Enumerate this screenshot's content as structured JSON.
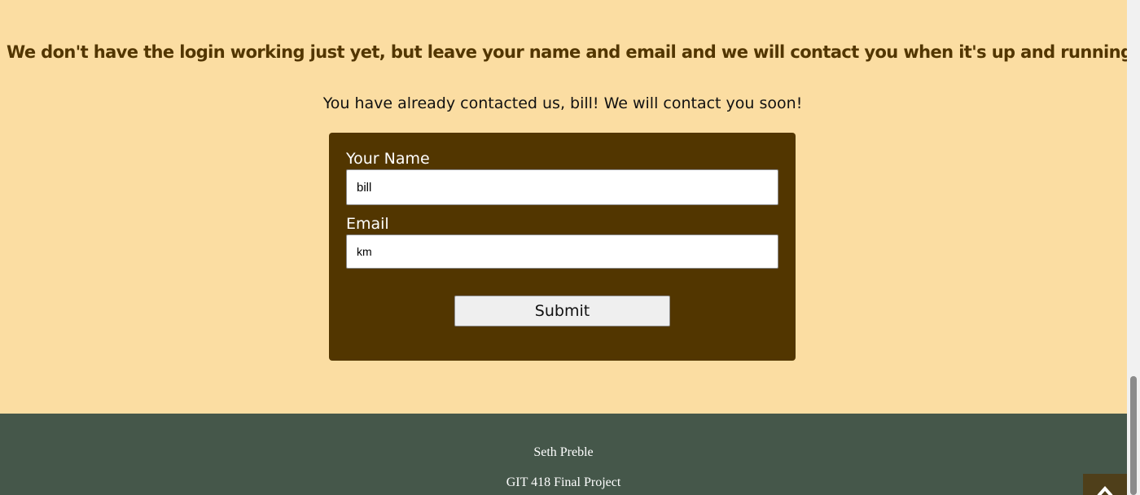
{
  "main": {
    "headline": "We don't have the login working just yet, but leave your name and email and we will contact you when it's up and running!",
    "notice": "You have already contacted us, bill! We will contact you soon!"
  },
  "form": {
    "name_label": "Your Name",
    "name_value": "bill",
    "email_label": "Email",
    "email_value": "km",
    "submit_label": "Submit"
  },
  "footer": {
    "author": "Seth Preble",
    "project": "GIT 418 Final Project"
  },
  "icons": {
    "back_to_top": "arrow-up-icon"
  },
  "colors": {
    "page_background": "#fbdda2",
    "headline": "#523600",
    "form_background": "#523600",
    "footer_background": "#45574a",
    "back_to_top_background": "#4f3f1a"
  }
}
